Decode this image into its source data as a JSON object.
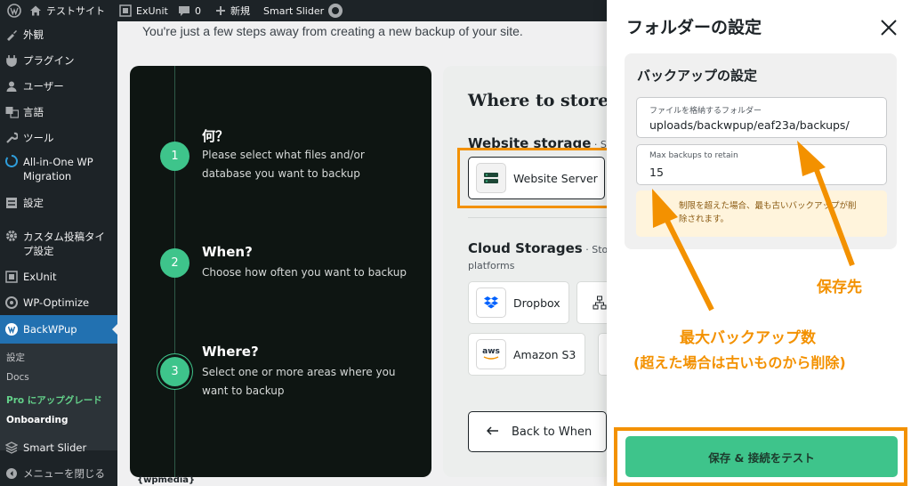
{
  "adminbar": {
    "site_name": "テストサイト",
    "exunit": "ExUnit",
    "comments_count": "0",
    "new_label": "新規",
    "smart_slider": "Smart Slider"
  },
  "sidebar": {
    "items": [
      {
        "label": "外観",
        "icon": "appearance-icon"
      },
      {
        "label": "プラグイン",
        "icon": "plugins-icon"
      },
      {
        "label": "ユーザー",
        "icon": "users-icon"
      },
      {
        "label": "言語",
        "icon": "language-icon"
      },
      {
        "label": "ツール",
        "icon": "tools-icon"
      },
      {
        "label": "All-in-One WP Migration",
        "icon": "migration-icon"
      },
      {
        "label": "設定",
        "icon": "settings-icon"
      },
      {
        "label": "カスタム投稿タイプ設定",
        "icon": "gear-icon"
      },
      {
        "label": "ExUnit",
        "icon": "exunit-icon"
      },
      {
        "label": "WP-Optimize",
        "icon": "optimize-icon"
      },
      {
        "label": "BackWPup",
        "icon": "backwpup-icon"
      },
      {
        "label": "Smart Slider",
        "icon": "slider-icon"
      },
      {
        "label": "メニューを閉じる",
        "icon": "collapse-icon"
      }
    ],
    "submenu": [
      "設定",
      "Docs",
      "Pro にアップグレード",
      "Onboarding"
    ]
  },
  "intro_text": "You're just a few steps away from creating a new backup of your site.",
  "steps": [
    {
      "number": "1",
      "title": "何？",
      "desc": "Please select what files and/or database you want to backup"
    },
    {
      "number": "2",
      "title": "When?",
      "desc": "Choose how often you want to backup"
    },
    {
      "number": "3",
      "title": "Where?",
      "desc": "Select one or more areas where you want to backup"
    }
  ],
  "storage": {
    "heading": "Where to store y",
    "website_storage": "Website storage",
    "website_storage_hint": " · Stor",
    "website_server": "Website Server",
    "cloud_storages": "Cloud Storages",
    "cloud_storages_hint": " · Store",
    "cloud_hint_2": "platforms",
    "dropbox": "Dropbox",
    "amazon_s3": "Amazon S3",
    "aws_logo": "aws",
    "back_button": "Back to When"
  },
  "panel": {
    "title": "フォルダーの設定",
    "card_title": "バックアップの設定",
    "folder_label": "ファイルを格納するフォルダー",
    "folder_value": "uploads/backwpup/eaf23a/backups/",
    "max_label": "Max backups to retain",
    "max_value": "15",
    "note_line1": "制限を超えた場合、最も古いバックアップが削",
    "note_line2": "除されます。",
    "save_button": "保存 & 接続をテスト"
  },
  "annotations": {
    "save_location": "保存先",
    "max_backups_line1": "最大バックアップ数",
    "max_backups_line2": "(超えた場合は古いものから削除)"
  },
  "footer_logo": "{wpmedia}",
  "colors": {
    "accent_orange": "#f39100",
    "brand_green": "#3ec48b",
    "wp_blue": "#2271b1"
  }
}
